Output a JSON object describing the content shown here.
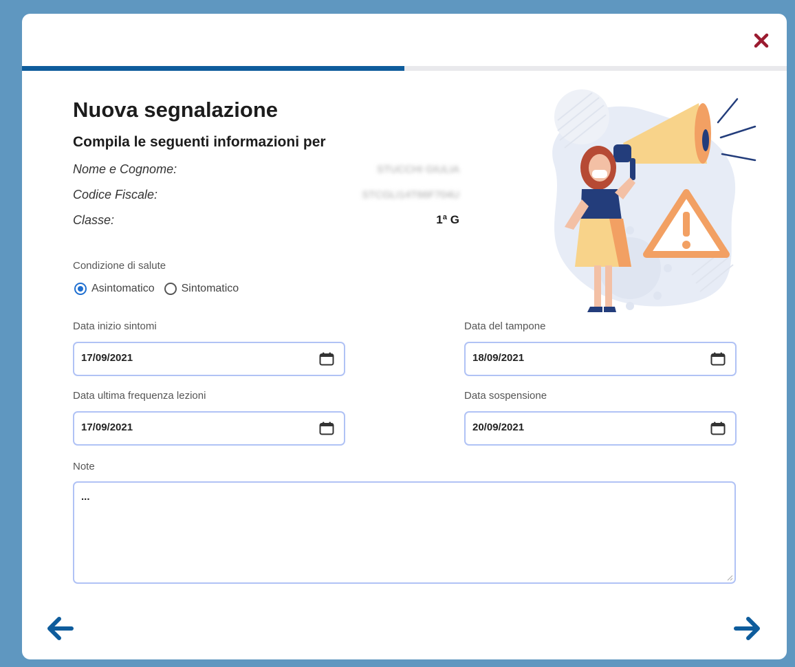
{
  "form": {
    "title": "Nuova segnalazione",
    "subtitle": "Compila le seguenti informazioni per",
    "progress_fraction": 0.5,
    "student": {
      "name_label": "Nome e Cognome:",
      "name_value": "STUCCHI GIULIA",
      "cf_label": "Codice Fiscale:",
      "cf_value": "STCGLI14T66F704U",
      "class_label": "Classe:",
      "class_value": "1ª G"
    },
    "health": {
      "label": "Condizione di salute",
      "options": [
        "Asintomatico",
        "Sintomatico"
      ],
      "selected": "Asintomatico"
    },
    "dates": {
      "symptoms_start_label": "Data inizio sintomi",
      "symptoms_start_value": "17/09/2021",
      "swab_label": "Data del tampone",
      "swab_value": "18/09/2021",
      "last_attendance_label": "Data ultima frequenza lezioni",
      "last_attendance_value": "17/09/2021",
      "suspension_label": "Data sospensione",
      "suspension_value": "20/09/2021"
    },
    "note_label": "Note",
    "note_value": "..."
  },
  "icons": {
    "close": "close-icon",
    "calendar": "calendar-icon",
    "back": "arrow-left-icon",
    "next": "arrow-right-icon"
  },
  "colors": {
    "background": "#5f97c0",
    "accent": "#0e5c9c",
    "close": "#9b1b30",
    "input_border": "#b0c2f5",
    "radio": "#1f6fd0"
  }
}
